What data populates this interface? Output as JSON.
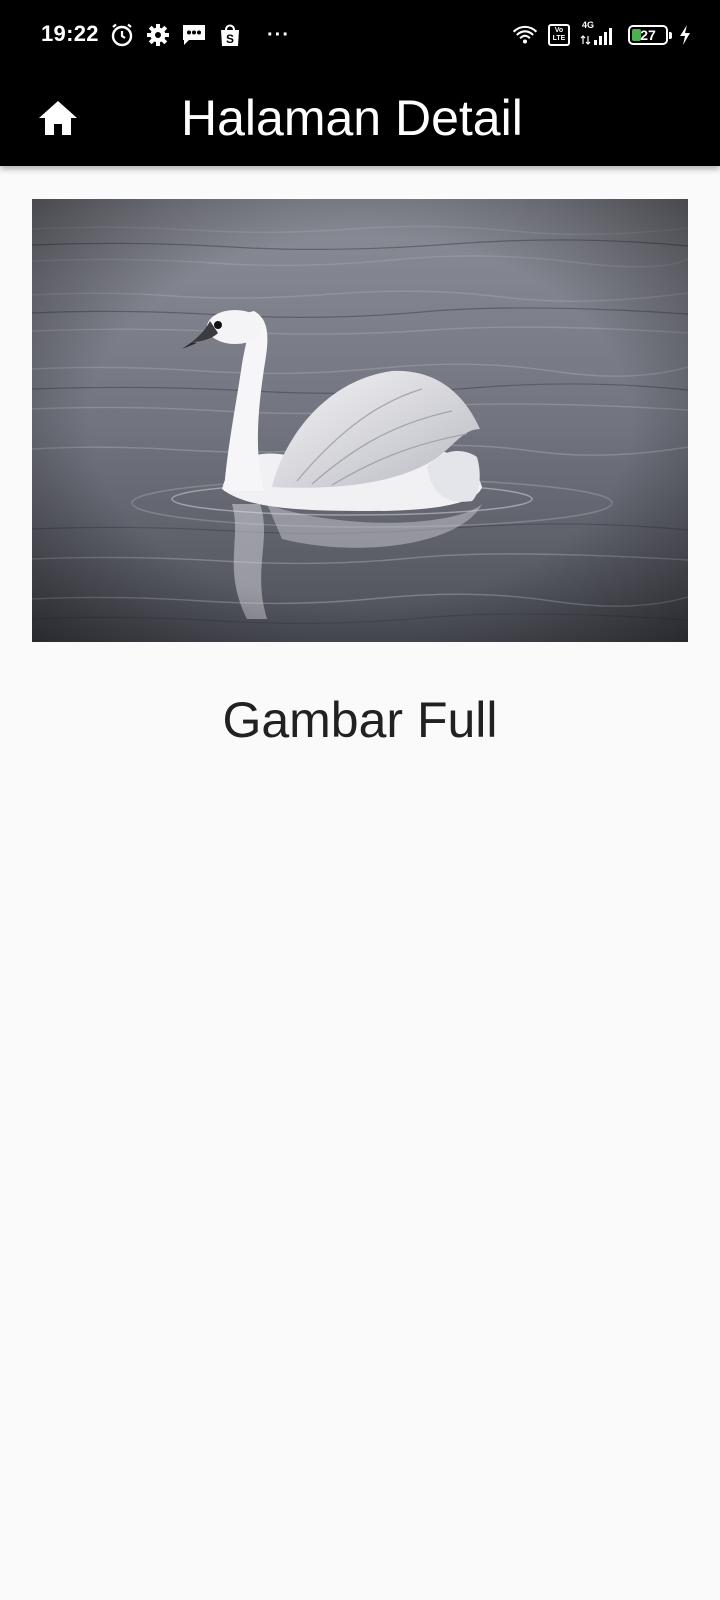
{
  "status_bar": {
    "time": "19:22",
    "left_icons": [
      "alarm-icon",
      "settings-icon",
      "message-icon",
      "shopee-icon"
    ],
    "more": "···",
    "volte": "Vo\nLTE",
    "network": "4G",
    "battery": {
      "level_percent": 27,
      "text": "27",
      "color": "#4caf50"
    }
  },
  "app_bar": {
    "title": "Halaman Detail",
    "home_icon": "home-icon",
    "background": "#000000"
  },
  "content": {
    "image_subject": "swan on lake",
    "caption": "Gambar Full"
  }
}
